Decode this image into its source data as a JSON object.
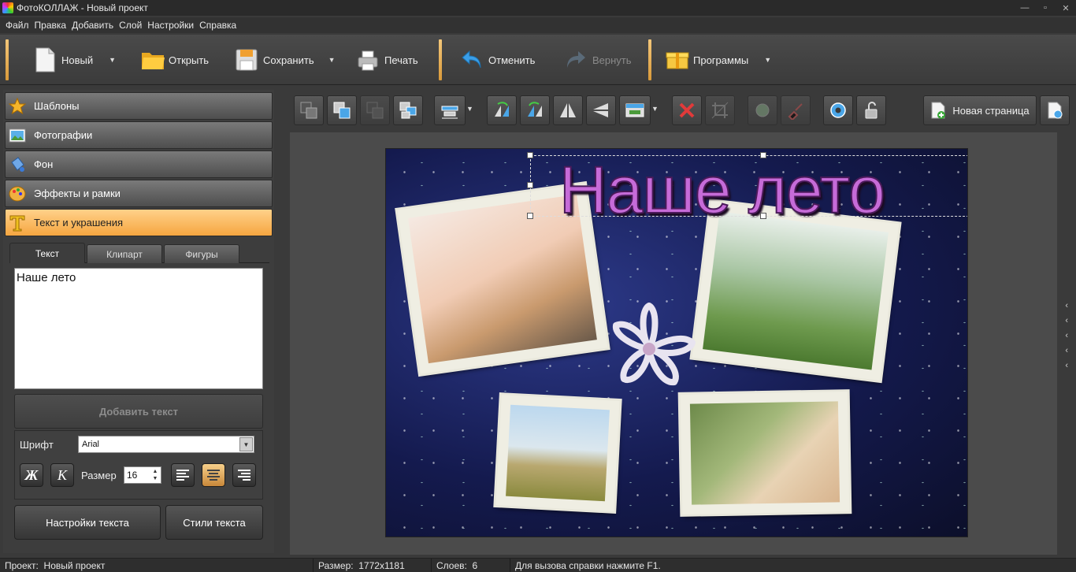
{
  "window": {
    "title": "ФотоКОЛЛАЖ - Новый проект",
    "controls": [
      "—",
      "▫",
      "✕"
    ]
  },
  "menu": [
    "Файл",
    "Правка",
    "Добавить",
    "Слой",
    "Настройки",
    "Справка"
  ],
  "toolbar": {
    "new": "Новый",
    "open": "Открыть",
    "save": "Сохранить",
    "print": "Печать",
    "undo": "Отменить",
    "redo": "Вернуть",
    "programs": "Программы"
  },
  "sidebar": {
    "sections": [
      "Шаблоны",
      "Фотографии",
      "Фон",
      "Эффекты и рамки",
      "Текст и украшения"
    ],
    "tabs": [
      "Текст",
      "Клипарт",
      "Фигуры"
    ],
    "text_value": "Наше лето",
    "add_text": "Добавить текст",
    "font_label": "Шрифт",
    "font_value": "Arial",
    "bold": "Ж",
    "italic": "К",
    "size_label": "Размер",
    "size_value": "16",
    "text_settings": "Настройки текста",
    "text_styles": "Стили текста"
  },
  "workspace": {
    "new_page": "Новая страница",
    "canvas_title": "Наше лето"
  },
  "status": {
    "project_label": "Проект:",
    "project": "Новый проект",
    "size_label": "Размер:",
    "size": "1772x1181",
    "layers_label": "Слоев:",
    "layers": "6",
    "hint": "Для вызова справки нажмите F1."
  },
  "colors": {
    "accent": "#f6a640",
    "canvas_bg": "#141a4e",
    "headline": "#c66bd8"
  }
}
